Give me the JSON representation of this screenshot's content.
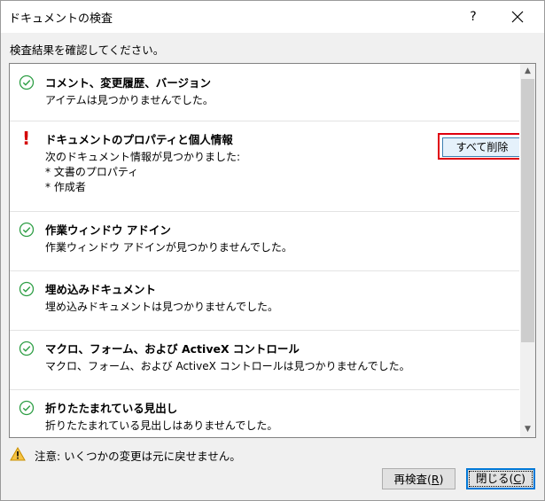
{
  "window": {
    "title": "ドキュメントの検査",
    "help_label": "?"
  },
  "instruction": "検査結果を確認してください。",
  "items": [
    {
      "status": "ok",
      "heading": "コメント、変更履歴、バージョン",
      "lines": [
        "アイテムは見つかりませんでした。"
      ]
    },
    {
      "status": "warning",
      "heading": "ドキュメントのプロパティと個人情報",
      "lines": [
        "次のドキュメント情報が見つかりました:",
        "* 文書のプロパティ",
        "* 作成者"
      ],
      "button_label": "すべて削除"
    },
    {
      "status": "ok",
      "heading": "作業ウィンドウ アドイン",
      "lines": [
        "作業ウィンドウ アドインが見つかりませんでした。"
      ]
    },
    {
      "status": "ok",
      "heading": "埋め込みドキュメント",
      "lines": [
        "埋め込みドキュメントは見つかりませんでした。"
      ]
    },
    {
      "status": "ok",
      "heading": "マクロ、フォーム、および ActiveX コントロール",
      "lines": [
        "マクロ、フォーム、および ActiveX コントロールは見つかりませんでした。"
      ]
    },
    {
      "status": "ok",
      "heading": "折りたたまれている見出し",
      "lines": [
        "折りたたまれている見出しはありませんでした。"
      ]
    }
  ],
  "footer": {
    "note": "注意: いくつかの変更は元に戻せません。",
    "recheck_label": "再検査(",
    "recheck_key": "R",
    "recheck_suffix": ")",
    "close_label": "閉じる(",
    "close_key": "C",
    "close_suffix": ")"
  },
  "colors": {
    "ok": "#2e9e45",
    "warning": "#d40000",
    "highlight": "#e0000e",
    "focus": "#0078d7"
  },
  "icons": {
    "ok": "check-circle-icon",
    "warning": "exclamation-icon",
    "note": "warning-triangle-icon"
  }
}
